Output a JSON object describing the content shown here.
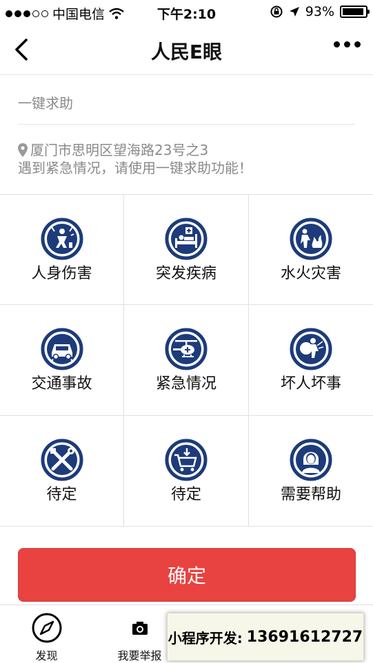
{
  "status_bar": {
    "carrier": "中国电信",
    "time": "下午2:10",
    "battery_percent": "93%",
    "battery_level": 0.93
  },
  "nav": {
    "title": "人民E眼"
  },
  "help": {
    "title": "一键求助"
  },
  "location": {
    "address": "厦门市思明区望海路23号之3",
    "hint": "遇到紧急情况，请使用一键求助功能！"
  },
  "grid": {
    "items": [
      {
        "label": "人身伤害",
        "icon": "injury-icon"
      },
      {
        "label": "突发疾病",
        "icon": "sudden-illness-icon"
      },
      {
        "label": "水火灾害",
        "icon": "fire-flood-icon"
      },
      {
        "label": "交通事故",
        "icon": "traffic-accident-icon"
      },
      {
        "label": "紧急情况",
        "icon": "emergency-helicopter-icon"
      },
      {
        "label": "坏人坏事",
        "icon": "thief-icon"
      },
      {
        "label": "待定",
        "icon": "tools-icon"
      },
      {
        "label": "待定",
        "icon": "cart-icon"
      },
      {
        "label": "需要帮助",
        "icon": "person-help-icon"
      }
    ]
  },
  "confirm": {
    "label": "确定"
  },
  "tabs": [
    {
      "label": "发现",
      "icon": "compass-icon"
    },
    {
      "label": "我要举报",
      "icon": "camera-icon"
    }
  ],
  "promo": {
    "label": "小程序开发:",
    "phone": "13691612727"
  },
  "colors": {
    "accent": "#e84340",
    "icon_blue": "#1d3b7a",
    "muted": "#8a8a8a"
  }
}
